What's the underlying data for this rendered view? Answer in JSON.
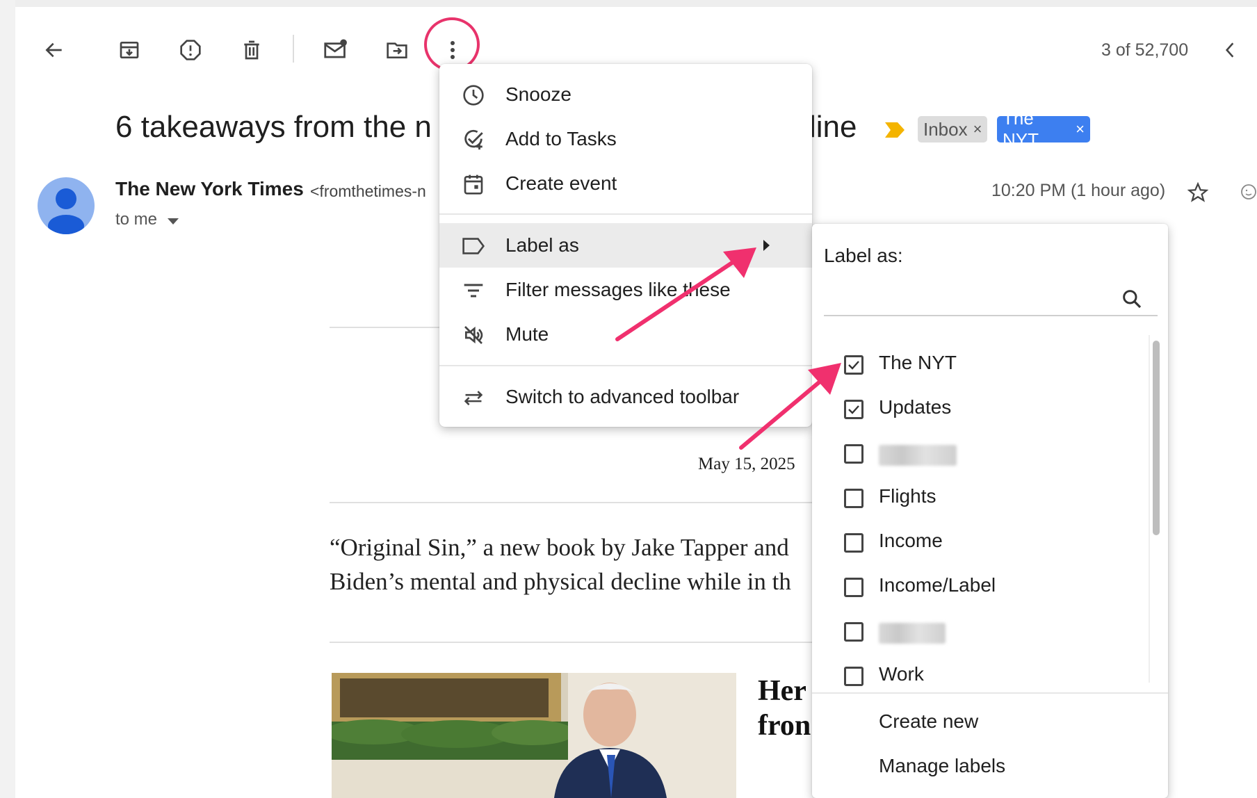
{
  "toolbar": {
    "back_icon": "arrow-left-icon",
    "archive_icon": "archive-icon",
    "spam_icon": "report-spam-icon",
    "delete_icon": "trash-icon",
    "mark_unread_icon": "mark-unread-icon",
    "move_icon": "move-to-folder-icon",
    "more_icon": "more-vert-icon",
    "counter": "3 of 52,700",
    "prev_icon": "chevron-left-icon"
  },
  "email": {
    "subject_start": "6 takeaways from the n",
    "subject_end": "line",
    "labels": [
      {
        "name": "Inbox",
        "color": "#dddddd"
      },
      {
        "name": "The NYT",
        "color": "#3d7ff0"
      }
    ],
    "label_remove_glyph": "×",
    "sender_name": "The New York Times",
    "sender_email": "<fromthetimes-n",
    "to": "to me",
    "time": "10:20 PM (1 hour ago)",
    "date": "May 15, 2025",
    "body_line1": "“Original Sin,” a new book by Jake Tapper and",
    "body_line2": "Biden’s mental and physical decline while in th",
    "headline_line1": "Her",
    "headline_line2": "fron"
  },
  "more_menu": {
    "items": [
      {
        "label": "Snooze",
        "icon": "clock-icon"
      },
      {
        "label": "Add to Tasks",
        "icon": "add-task-icon"
      },
      {
        "label": "Create event",
        "icon": "calendar-icon"
      },
      {
        "label": "Label as",
        "icon": "label-icon"
      },
      {
        "label": "Filter messages like these",
        "icon": "filter-icon"
      },
      {
        "label": "Mute",
        "icon": "mute-icon"
      },
      {
        "label": "Switch to advanced toolbar",
        "icon": "swap-icon"
      }
    ]
  },
  "label_menu": {
    "title": "Label as:",
    "search_icon": "search-icon",
    "labels": [
      {
        "name": "The NYT",
        "checked": true
      },
      {
        "name": "Updates",
        "checked": true
      },
      {
        "name": "",
        "checked": false
      },
      {
        "name": "Flights",
        "checked": false
      },
      {
        "name": "Income",
        "checked": false
      },
      {
        "name": "Income/Label",
        "checked": false
      },
      {
        "name": "",
        "checked": false
      },
      {
        "name": "Work",
        "checked": false
      }
    ],
    "create_new": "Create new",
    "manage_labels": "Manage labels"
  },
  "colors": {
    "highlight_circle": "#e8336b",
    "annotation_arrow": "#f0306e",
    "important_marker": "#f4b400"
  }
}
